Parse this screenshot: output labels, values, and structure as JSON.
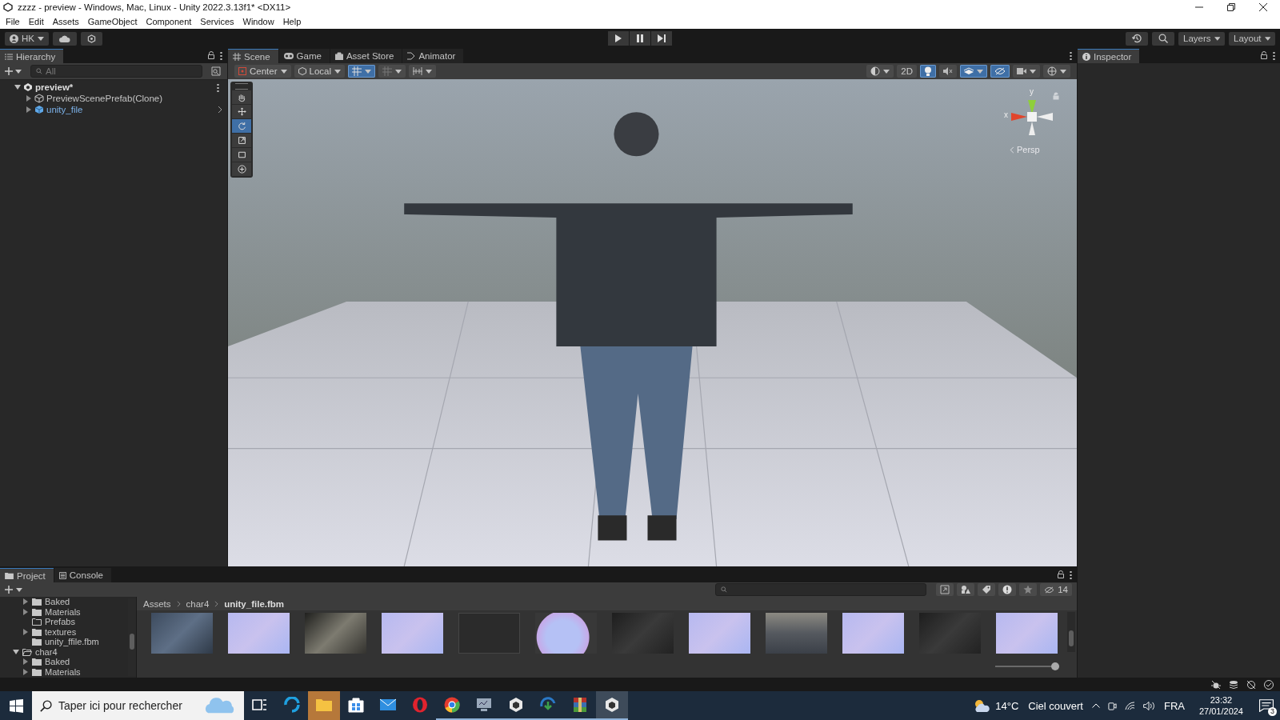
{
  "window": {
    "title": "zzzz - preview - Windows, Mac, Linux - Unity 2022.3.13f1* <DX11>"
  },
  "menu": [
    "File",
    "Edit",
    "Assets",
    "GameObject",
    "Component",
    "Services",
    "Window",
    "Help"
  ],
  "toolbar": {
    "account": "HK",
    "layers": "Layers",
    "layout": "Layout"
  },
  "hierarchy": {
    "tab": "Hierarchy",
    "search_placeholder": "All",
    "items": [
      {
        "label": "preview*",
        "kind": "scene",
        "expanded": true,
        "children": [
          {
            "label": "PreviewScenePrefab(Clone)",
            "kind": "object",
            "expanded": false
          },
          {
            "label": "unity_file",
            "kind": "prefab",
            "expanded": false
          }
        ]
      }
    ]
  },
  "scene_tabs": [
    {
      "label": "Scene",
      "kind": "scene",
      "selected": true
    },
    {
      "label": "Game",
      "kind": "game",
      "selected": false
    },
    {
      "label": "Asset Store",
      "kind": "store",
      "selected": false
    },
    {
      "label": "Animator",
      "kind": "animator",
      "selected": false
    }
  ],
  "scene_toolbar": {
    "pivot": "Center",
    "space": "Local",
    "grid_snapping": {
      "on": true
    },
    "twod": {
      "label": "2D",
      "on": false
    },
    "toggles": [
      {
        "kind": "lighting",
        "on": true
      },
      {
        "kind": "audio",
        "on": false
      },
      {
        "kind": "effects",
        "on": true
      },
      {
        "kind": "visibility",
        "on": true
      },
      {
        "kind": "camera",
        "on": false
      },
      {
        "kind": "gizmos",
        "on": false
      }
    ]
  },
  "tools": [
    {
      "kind": "hand",
      "selected": false
    },
    {
      "kind": "move",
      "selected": false
    },
    {
      "kind": "rotate",
      "selected": true
    },
    {
      "kind": "scale",
      "selected": false
    },
    {
      "kind": "rect",
      "selected": false
    },
    {
      "kind": "transform",
      "selected": false
    }
  ],
  "gizmo": {
    "y_label": "y",
    "x_label": "x",
    "projection": "Persp"
  },
  "inspector": {
    "tab": "Inspector"
  },
  "project": {
    "tabs": [
      {
        "label": "Project",
        "selected": true
      },
      {
        "label": "Console",
        "selected": false
      }
    ],
    "tree_continued": [
      {
        "label": "Baked",
        "kind": "folder",
        "expanded": false
      },
      {
        "label": "Materials",
        "kind": "folder",
        "expanded": false
      },
      {
        "label": "Prefabs",
        "kind": "empty_folder"
      },
      {
        "label": "textures",
        "kind": "folder",
        "expanded": false
      },
      {
        "label": "unity_ffile.fbm",
        "kind": "folder"
      }
    ],
    "tree": [
      {
        "label": "char4",
        "kind": "open_folder",
        "expanded": true,
        "children": [
          {
            "label": "Baked",
            "kind": "folder",
            "expanded": false
          },
          {
            "label": "Materials",
            "kind": "folder",
            "expanded": false
          }
        ]
      }
    ],
    "breadcrumb": [
      "Assets",
      "char4",
      "unity_file.fbm"
    ],
    "hidden_count": "14",
    "thumbnails": [
      {
        "kind": "denim"
      },
      {
        "kind": "normal"
      },
      {
        "kind": "stone"
      },
      {
        "kind": "normal"
      },
      {
        "kind": "empty"
      },
      {
        "kind": "sphere"
      },
      {
        "kind": "dark"
      },
      {
        "kind": "normal"
      },
      {
        "kind": "grey"
      },
      {
        "kind": "normal"
      },
      {
        "kind": "dark"
      },
      {
        "kind": "normal"
      }
    ],
    "thumbnail_slider": {
      "level": 1
    }
  },
  "taskbar": {
    "search_placeholder": "Taper ici pour rechercher",
    "apps": [
      {
        "kind": "taskview",
        "running": false,
        "highlighted": false,
        "focused": false
      },
      {
        "kind": "edge",
        "running": false,
        "highlighted": false,
        "focused": false
      },
      {
        "kind": "explorer",
        "running": false,
        "highlighted": true,
        "focused": false
      },
      {
        "kind": "store",
        "running": false,
        "highlighted": false,
        "focused": false
      },
      {
        "kind": "mail",
        "running": false,
        "highlighted": false,
        "focused": false
      },
      {
        "kind": "opera",
        "running": false,
        "highlighted": false,
        "focused": false
      },
      {
        "kind": "chrome",
        "running": true,
        "highlighted": false,
        "focused": false
      },
      {
        "kind": "monitor",
        "running": true,
        "highlighted": false,
        "focused": false
      },
      {
        "kind": "hub",
        "running": true,
        "highlighted": false,
        "focused": false
      },
      {
        "kind": "download",
        "running": true,
        "highlighted": false,
        "focused": false
      },
      {
        "kind": "archive",
        "running": true,
        "highlighted": false,
        "focused": false
      },
      {
        "kind": "unity",
        "running": true,
        "highlighted": false,
        "focused": true
      }
    ],
    "temperature": "14°C",
    "weather": "Ciel couvert",
    "language": "FRA",
    "time": "23:32",
    "date": "27/01/2024",
    "notifications": "3"
  }
}
